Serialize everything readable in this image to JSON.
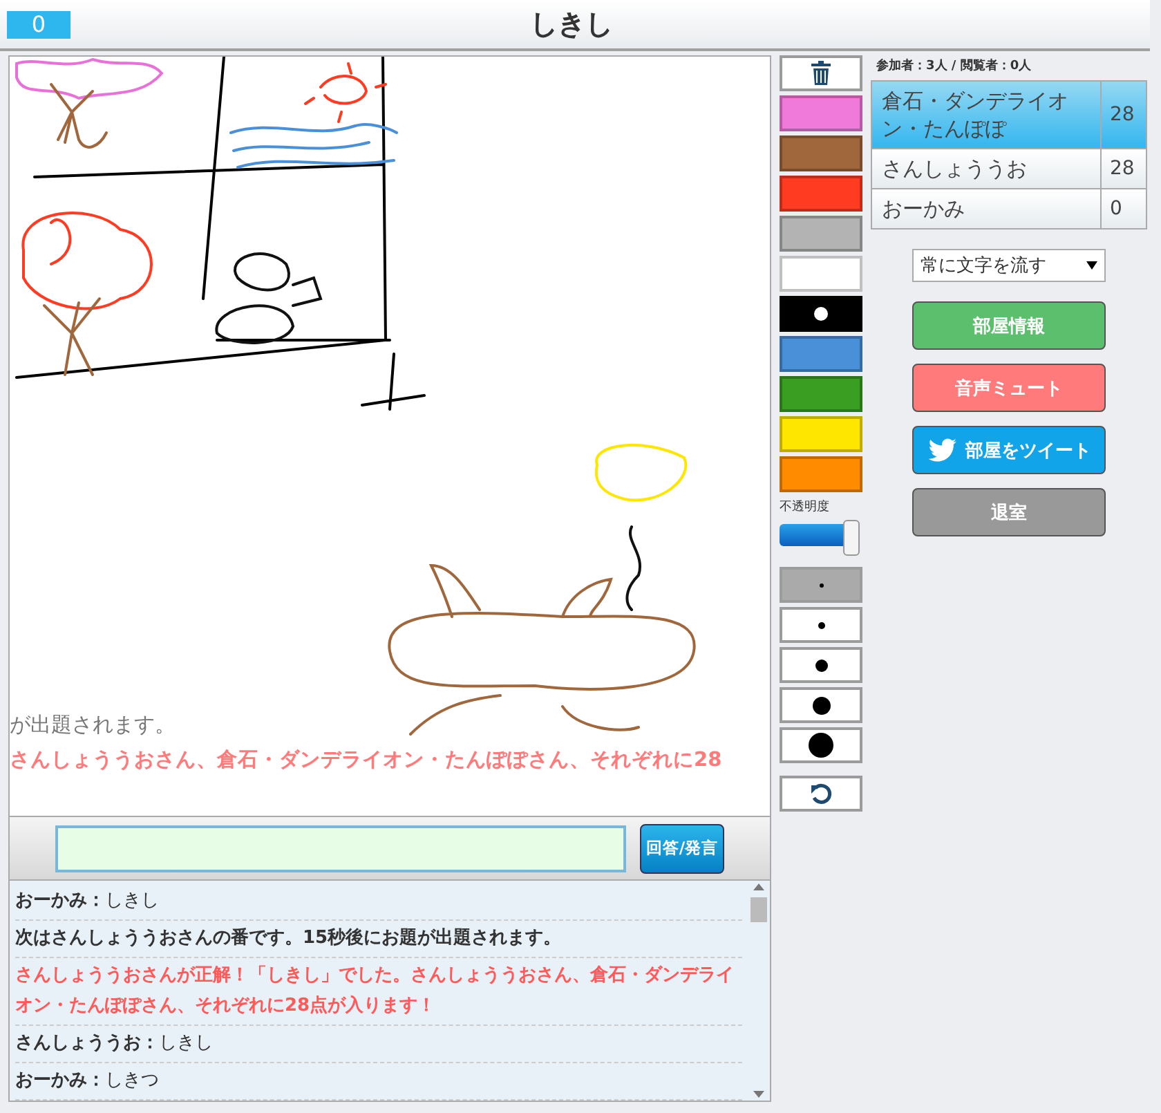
{
  "header": {
    "score": "0",
    "title": "しきし"
  },
  "canvas": {
    "overlay_lines": [
      {
        "kind": "info",
        "text": "が出題されます。"
      },
      {
        "kind": "alert",
        "text": "さんしょううおさん、倉石・ダンデライオン・たんぽぽさん、それぞれに28"
      }
    ]
  },
  "tools": {
    "colors": [
      {
        "color": "#f07ad9",
        "selected": false
      },
      {
        "color": "#a0673c",
        "selected": false
      },
      {
        "color": "#ff3b22",
        "selected": false
      },
      {
        "color": "#b3b3b3",
        "selected": false
      },
      {
        "color": "#ffffff",
        "selected": false
      },
      {
        "color": "#000000",
        "selected": true
      },
      {
        "color": "#4a90d9",
        "selected": false
      },
      {
        "color": "#3a9e23",
        "selected": false
      },
      {
        "color": "#ffe600",
        "selected": false
      },
      {
        "color": "#ff8c00",
        "selected": false
      }
    ],
    "opacity": {
      "label": "不透明度",
      "level": 1
    },
    "sizes": [
      {
        "selected": true
      },
      {
        "selected": false
      },
      {
        "selected": false
      },
      {
        "selected": false
      },
      {
        "selected": false
      }
    ]
  },
  "players": {
    "summary": "参加者：3人 / 閲覧者：0人",
    "rows": [
      {
        "name": "倉石・ダンデライオン・たんぽぽ",
        "score": "28",
        "selected": true
      },
      {
        "name": "さんしょううお",
        "score": "28",
        "selected": false
      },
      {
        "name": "おーかみ",
        "score": "0",
        "selected": false
      }
    ]
  },
  "flow_select": {
    "value": "常に文字を流す"
  },
  "buttons": [
    {
      "kind": "info",
      "label": "部屋情報"
    },
    {
      "kind": "mute",
      "label": "音声ミュート"
    },
    {
      "kind": "tweet",
      "label": "部屋をツイート"
    },
    {
      "kind": "leave",
      "label": "退室"
    }
  ],
  "answer": {
    "button": "回答/発言"
  },
  "chat": [
    {
      "kind": "chat",
      "name": "おーかみ：",
      "text": "しきし"
    },
    {
      "kind": "system",
      "text": "次はさんしょううおさんの番です。15秒後にお題が出題されます。"
    },
    {
      "kind": "correct",
      "text": "さんしょううおさんが正解！「しきし」でした。さんしょううおさん、倉石・ダンデライオン・たんぽぽさん、それぞれに28点が入ります！"
    },
    {
      "kind": "chat",
      "name": "さんしょううお：",
      "text": "しきし"
    },
    {
      "kind": "chat",
      "name": "おーかみ：",
      "text": "しきつ"
    }
  ]
}
